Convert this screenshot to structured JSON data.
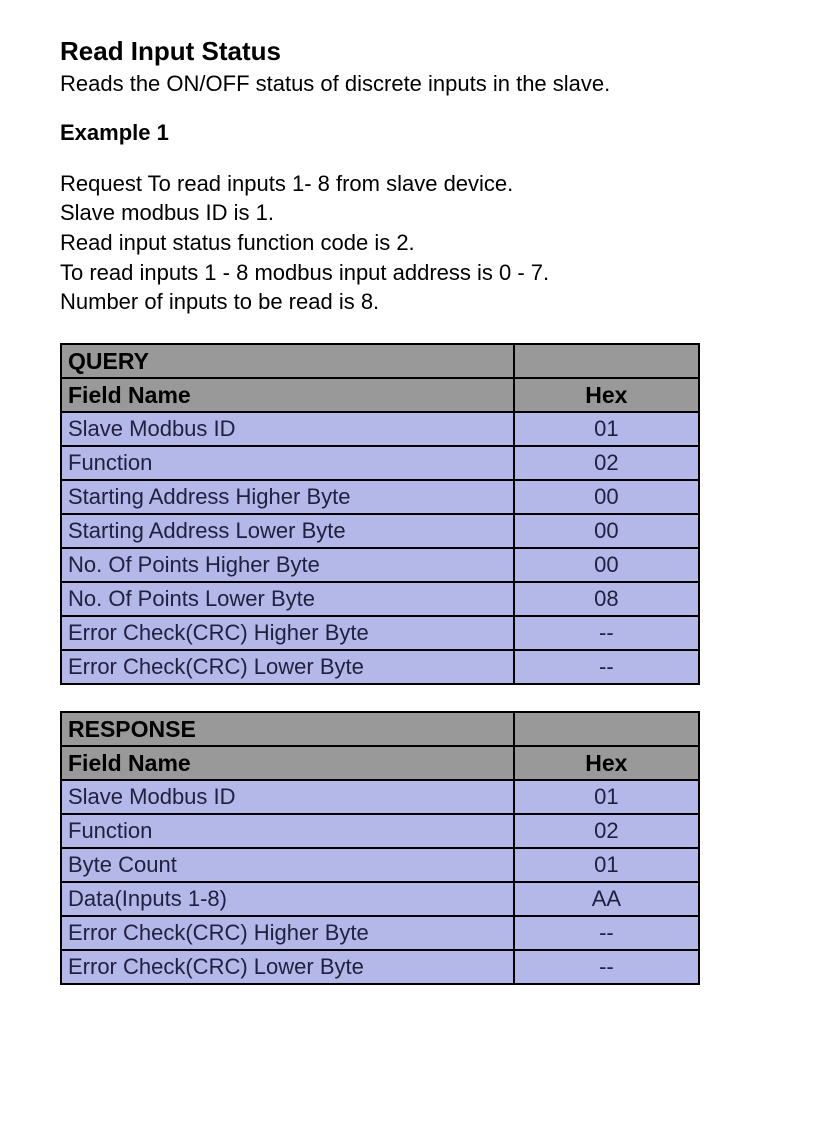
{
  "title": "Read Input Status",
  "subtitle": "Reads the ON/OFF status of discrete inputs in the slave.",
  "example_label": "Example 1",
  "desc": [
    "Request To read inputs 1- 8 from slave device.",
    "Slave modbus ID is 1.",
    "Read input status function code is 2.",
    "To read inputs 1 - 8 modbus input address is 0 - 7.",
    "Number of inputs to be read is 8."
  ],
  "tables": [
    {
      "name": "QUERY",
      "col_label": "Field Name",
      "col_hex": "Hex",
      "rows": [
        {
          "label": "Slave Modbus ID",
          "hex": "01"
        },
        {
          "label": "Function",
          "hex": "02"
        },
        {
          "label": "Starting Address Higher Byte",
          "hex": "00"
        },
        {
          "label": "Starting Address Lower Byte",
          "hex": "00"
        },
        {
          "label": "No. Of Points Higher Byte",
          "hex": "00"
        },
        {
          "label": "No. Of Points Lower Byte",
          "hex": "08"
        },
        {
          "label": "Error Check(CRC) Higher Byte",
          "hex": "--"
        },
        {
          "label": "Error Check(CRC) Lower Byte",
          "hex": "--"
        }
      ]
    },
    {
      "name": "RESPONSE",
      "col_label": "Field Name",
      "col_hex": "Hex",
      "rows": [
        {
          "label": "Slave Modbus ID",
          "hex": "01"
        },
        {
          "label": "Function",
          "hex": "02"
        },
        {
          "label": "Byte Count",
          "hex": "01"
        },
        {
          "label": "Data(Inputs 1-8)",
          "hex": "AA"
        },
        {
          "label": "Error Check(CRC) Higher Byte",
          "hex": "--"
        },
        {
          "label": "Error Check(CRC) Lower Byte",
          "hex": "--"
        }
      ]
    }
  ]
}
